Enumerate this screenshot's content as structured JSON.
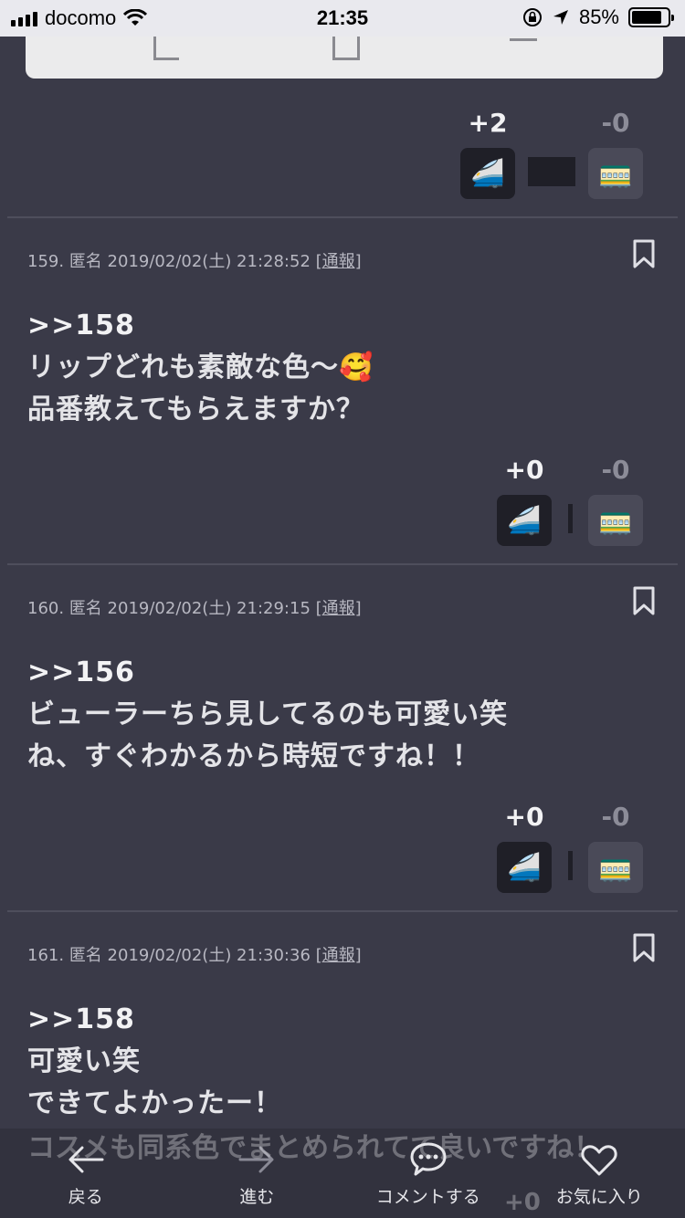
{
  "status_bar": {
    "carrier": "docomo",
    "time": "21:35",
    "battery": "85%"
  },
  "comments": [
    {
      "votes": {
        "plus": "+2",
        "minus": "-0"
      }
    },
    {
      "number": "159.",
      "author": "匿名",
      "datetime": "2019/02/02(土) 21:28:52",
      "report": "[通報]",
      "anchor": ">>158",
      "lines": [
        "リップどれも素敵な色〜🥰",
        "品番教えてもらえますか？"
      ],
      "votes": {
        "plus": "+0",
        "minus": "-0"
      }
    },
    {
      "number": "160.",
      "author": "匿名",
      "datetime": "2019/02/02(土) 21:29:15",
      "report": "[通報]",
      "anchor": ">>156",
      "lines": [
        "ビューラーちら見してるのも可愛い笑",
        "ね、すぐわかるから時短ですね！！"
      ],
      "votes": {
        "plus": "+0",
        "minus": "-0"
      }
    },
    {
      "number": "161.",
      "author": "匿名",
      "datetime": "2019/02/02(土) 21:30:36",
      "report": "[通報]",
      "anchor": ">>158",
      "lines": [
        "可愛い笑",
        "できてよかったー！"
      ],
      "overflow_line": "コスメも同系色でまとめられてて良いですね！",
      "overflow_votes": "+0"
    }
  ],
  "icons": {
    "up_vote": "🚄",
    "down_vote": "🚃"
  },
  "bottom_nav": {
    "back": "戻る",
    "forward": "進む",
    "comment": "コメントする",
    "favorite": "お気に入り"
  }
}
